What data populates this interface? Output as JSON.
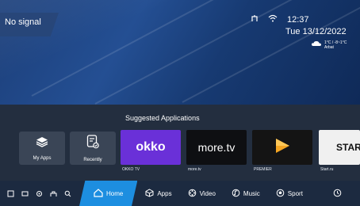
{
  "status": {
    "no_signal": "No signal",
    "time": "12:37",
    "date": "Tue 13/12/2022",
    "weather_temp": "1°C / -8~1°C",
    "weather_city": "Arbat"
  },
  "apps_section": {
    "title": "Suggested Applications",
    "shortcuts": [
      {
        "label": "My Apps",
        "icon": "layers-icon"
      },
      {
        "label": "Recently",
        "icon": "recent-doc-icon"
      }
    ],
    "apps": [
      {
        "name": "okko",
        "caption": "OKKO TV",
        "color": "#5b2bd6"
      },
      {
        "name": "more.tv",
        "caption": "more.tv",
        "color": "#0e0f12"
      },
      {
        "name": "premier",
        "caption": "PREMIER",
        "color": "#141414"
      },
      {
        "name": "START",
        "caption": "Start.ru",
        "color": "#f0f0f0"
      }
    ]
  },
  "navbar": {
    "tabs": [
      {
        "label": "Home",
        "icon": "home-icon",
        "active": true
      },
      {
        "label": "Apps",
        "icon": "cube-icon"
      },
      {
        "label": "Video",
        "icon": "film-reel-icon"
      },
      {
        "label": "Music",
        "icon": "music-note-icon"
      },
      {
        "label": "Sport",
        "icon": "soccer-ball-icon"
      }
    ]
  }
}
